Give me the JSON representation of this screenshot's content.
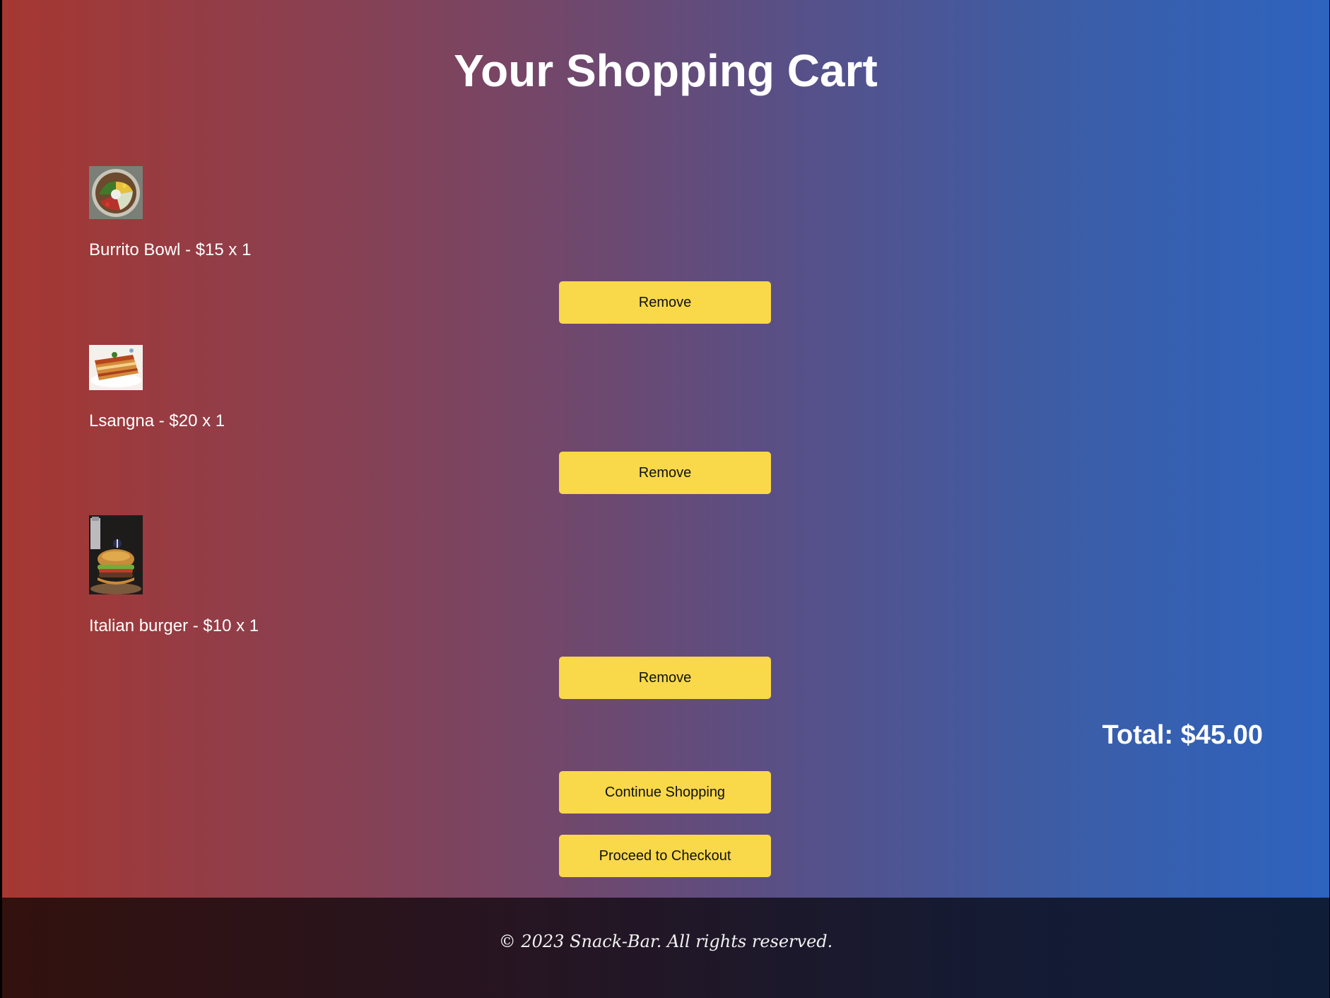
{
  "header": {
    "title": "Your Shopping Cart"
  },
  "cart": {
    "items": [
      {
        "label": "Burrito Bowl - $15 x 1",
        "image": "burrito-bowl-photo",
        "remove_label": "Remove"
      },
      {
        "label": "Lsangna - $20 x 1",
        "image": "lasagna-photo",
        "remove_label": "Remove"
      },
      {
        "label": "Italian burger - $10 x 1",
        "image": "italian-burger-photo",
        "remove_label": "Remove"
      }
    ],
    "total": "Total: $45.00"
  },
  "actions": {
    "continue_label": "Continue Shopping",
    "checkout_label": "Proceed to Checkout"
  },
  "footer": {
    "copyright": "© 2023 Snack-Bar. All rights reserved."
  },
  "colors": {
    "button": "#f9d84a",
    "gradient_left": "#a63731",
    "gradient_right": "#2e63bf",
    "footer_bg": "#1b1829"
  }
}
